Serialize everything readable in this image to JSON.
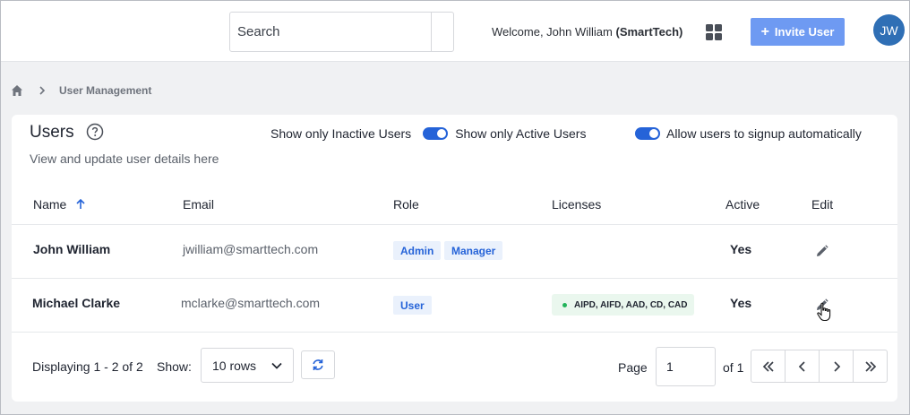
{
  "header": {
    "search_placeholder": "Search",
    "welcome_prefix": "Welcome, John William",
    "welcome_org": "(SmartTech)",
    "invite_label": "Invite User",
    "avatar_initials": "JW",
    "accent_color": "#6e9af2"
  },
  "breadcrumb": {
    "current": "User Management"
  },
  "users_panel": {
    "title": "Users",
    "subtitle": "View and update user details here",
    "toggles": [
      {
        "label_before": "Show only Inactive Users",
        "label_after": "Show only Active Users",
        "on": true
      },
      {
        "label_after": "Allow users to signup automatically",
        "on": true
      }
    ]
  },
  "table": {
    "columns": [
      "Name",
      "Email",
      "Role",
      "Licenses",
      "Active",
      "Edit"
    ],
    "sort_column": "Name",
    "rows": [
      {
        "name": "John William",
        "email": "jwilliam@smarttech.com",
        "roles": [
          "Admin",
          "Manager"
        ],
        "licenses": "",
        "active": "Yes"
      },
      {
        "name": "Michael Clarke",
        "email": "mclarke@smarttech.com",
        "roles": [
          "User"
        ],
        "licenses": "AIPD, AIFD, AAD, CD, CAD",
        "active": "Yes"
      }
    ]
  },
  "footer": {
    "displaying": "Displaying 1 - 2 of 2",
    "show_label": "Show:",
    "rows_option": "10 rows",
    "page_label": "Page",
    "page_value": "1",
    "of_label": "of 1"
  }
}
